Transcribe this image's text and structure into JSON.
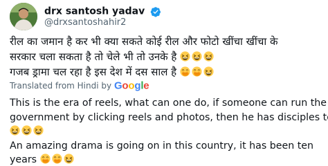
{
  "author": {
    "display_name": "drx santosh yadav",
    "handle": "@drxsantoshahir2",
    "verified": true
  },
  "tweet": {
    "hindi_line1": "रील का जमान है कर भी क्या सकते कोई रील और फोटो खींचा खींचा के",
    "hindi_line2": "सरकार चला सकता है तो चेले भी तो उनके है",
    "hindi_line3": " गजब ड्रामा चल रहा है इस देश में दस साल है",
    "translated_label": "Translated from Hindi by",
    "google_letters": [
      "G",
      "o",
      "o",
      "g",
      "l",
      "e"
    ],
    "english_line1": "This is the era of reels, what can one do, if someone can run the",
    "english_line2": "government by clicking reels and photos, then he has disciples too",
    "english_line3": "An amazing drama is going on in this country, it has been ten",
    "english_line4": "years"
  },
  "emojis": {
    "laugh": "grinning-squinting-face",
    "cover": "face-with-hand-over-mouth"
  },
  "colors": {
    "text": "#0f1419",
    "muted": "#536471",
    "verified": "#1d9bf0",
    "emoji_yellow": "#ffcc4d",
    "google": [
      "#4285f4",
      "#ea4335",
      "#fbbc05",
      "#4285f4",
      "#34a853",
      "#ea4335"
    ]
  }
}
